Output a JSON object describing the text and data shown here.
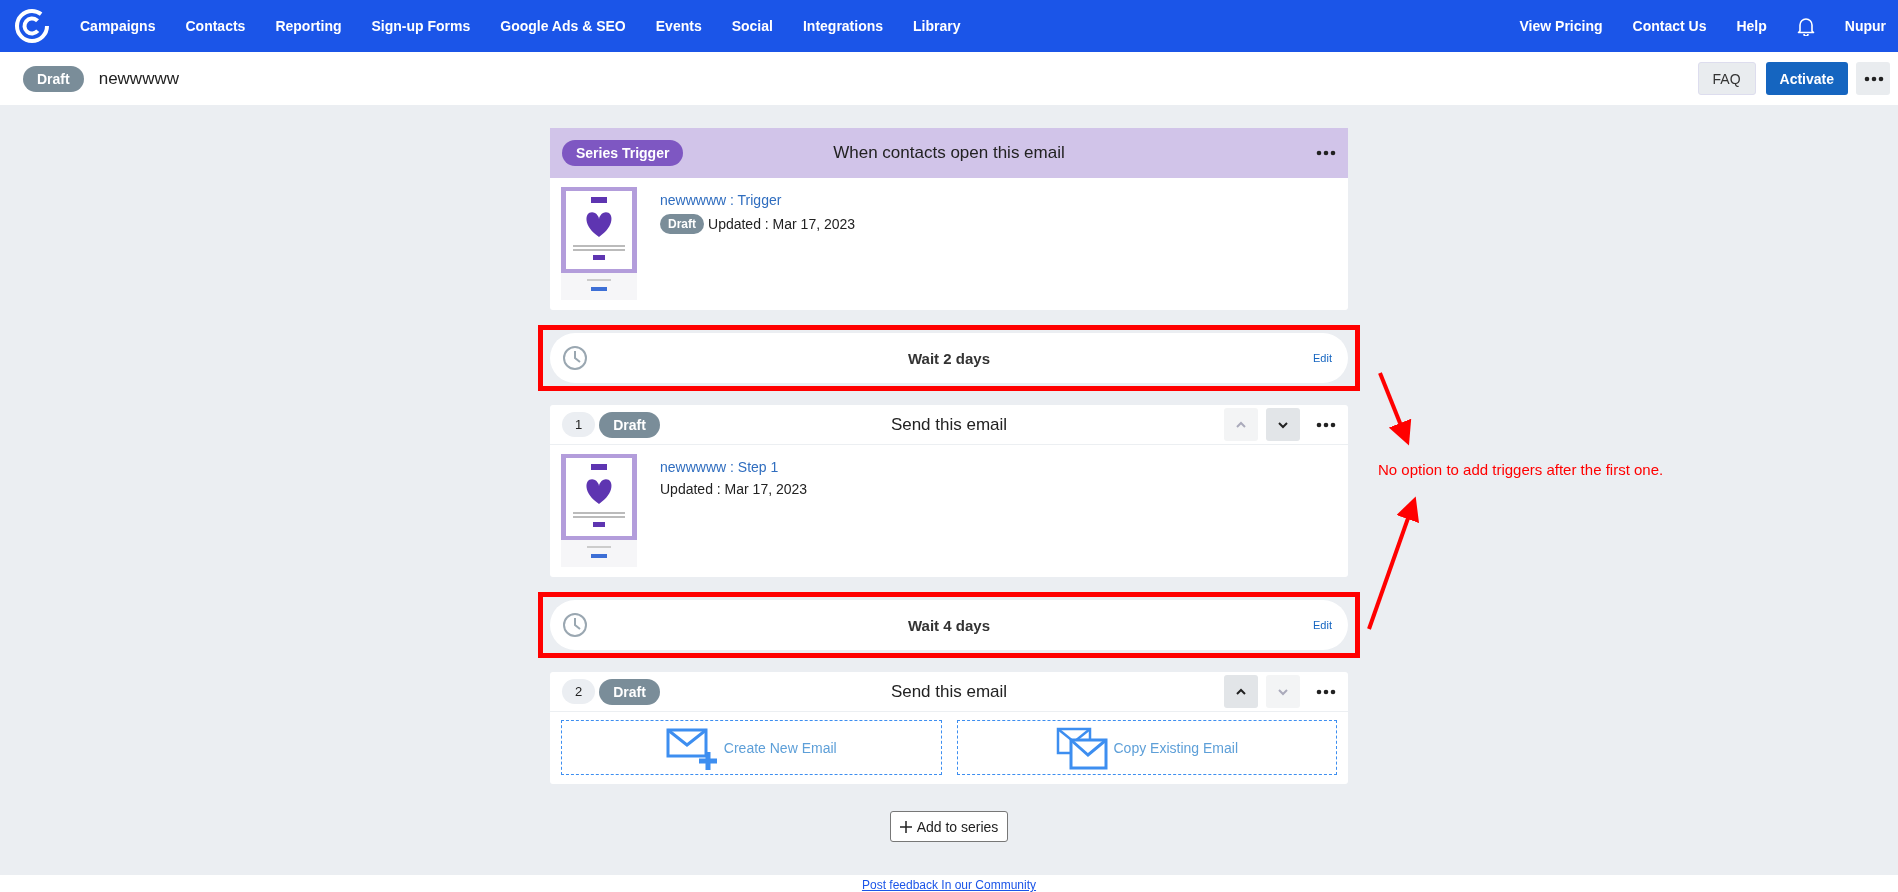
{
  "nav": {
    "items": [
      {
        "label": "Campaigns"
      },
      {
        "label": "Contacts"
      },
      {
        "label": "Reporting"
      },
      {
        "label": "Sign-up Forms"
      },
      {
        "label": "Google Ads & SEO"
      },
      {
        "label": "Events"
      },
      {
        "label": "Social"
      },
      {
        "label": "Integrations"
      },
      {
        "label": "Library"
      }
    ],
    "right_items": [
      {
        "label": "View Pricing"
      },
      {
        "label": "Contact Us"
      },
      {
        "label": "Help"
      }
    ],
    "user": "Nupur"
  },
  "header": {
    "status": "Draft",
    "title": "newwwww",
    "buttons": [
      {
        "label": "FAQ",
        "kind": "secondary"
      },
      {
        "label": "Activate",
        "kind": "primary"
      }
    ]
  },
  "trigger": {
    "badge": "Series Trigger",
    "title": "When contacts open this email",
    "email_name": "newwwww : Trigger",
    "status": "Draft",
    "updated": "Updated : Mar 17, 2023"
  },
  "sequence": [
    {
      "kind": "wait",
      "label": "Wait 2 days",
      "edit": "Edit",
      "highlighted": true
    },
    {
      "kind": "step",
      "number": "1",
      "status": "Draft",
      "title": "Send this email",
      "up_enabled": false,
      "down_enabled": true,
      "email": {
        "name": "newwwww : Step 1",
        "updated": "Updated : Mar 17, 2023"
      }
    },
    {
      "kind": "wait",
      "label": "Wait 4 days",
      "edit": "Edit",
      "highlighted": true
    },
    {
      "kind": "step",
      "number": "2",
      "status": "Draft",
      "title": "Send this email",
      "up_enabled": true,
      "down_enabled": false,
      "options": [
        {
          "kind": "create",
          "label": "Create New Email"
        },
        {
          "kind": "copy",
          "label": "Copy Existing Email"
        }
      ]
    }
  ],
  "add_button": "Add to series",
  "annotation": "No option to add triggers after the first one.",
  "footer_link": "Post feedback In our Community"
}
